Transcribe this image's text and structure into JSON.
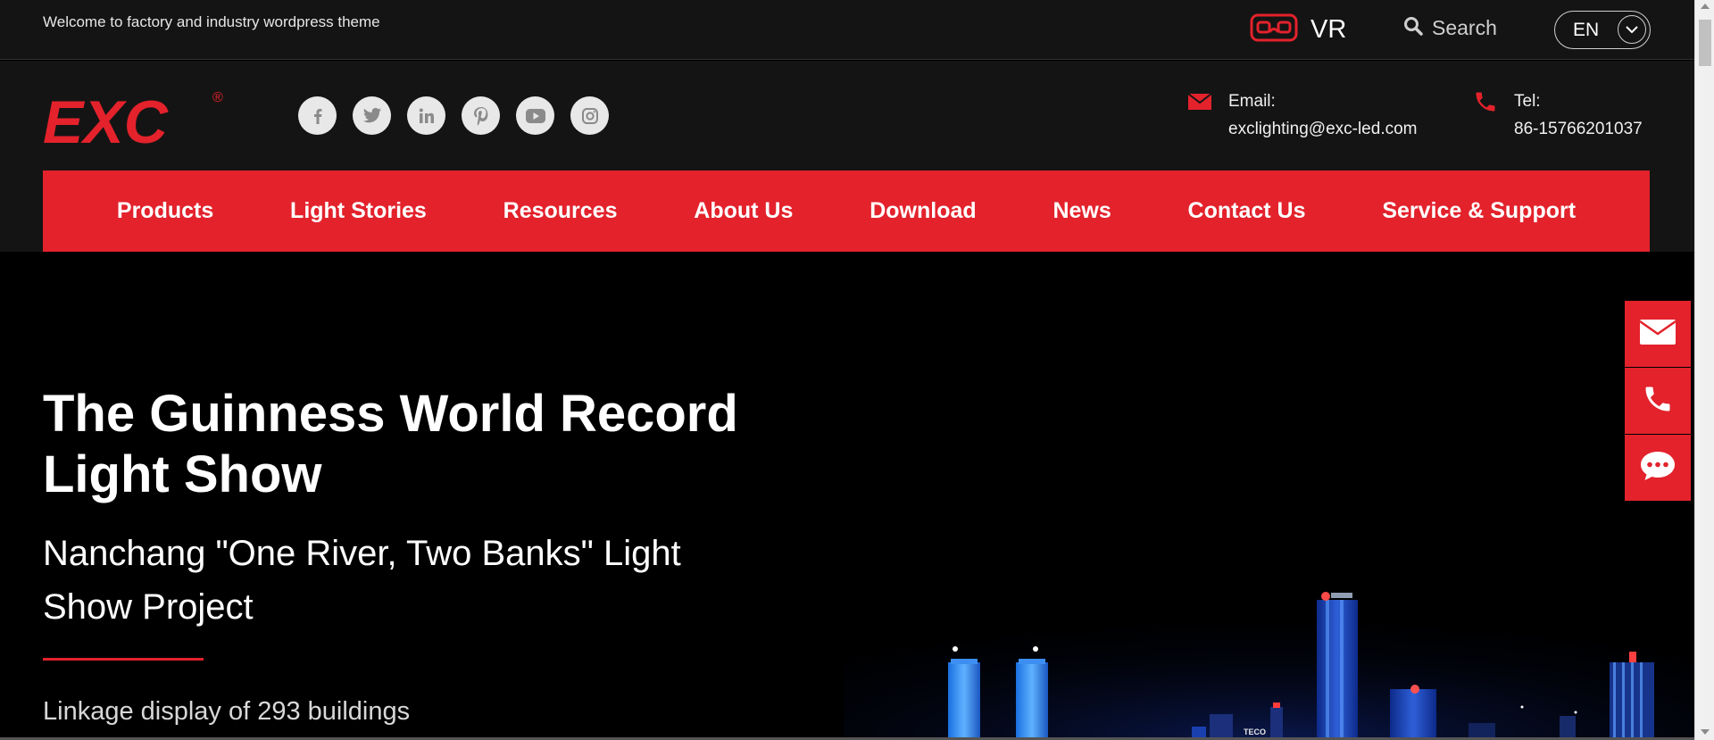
{
  "topbar": {
    "welcome": "Welcome to factory and industry wordpress theme",
    "vr_label": "VR",
    "search_label": "Search",
    "lang_label": "EN"
  },
  "header": {
    "logo_text": "EXC",
    "logo_mark": "®",
    "socials": [
      {
        "icon": "facebook-icon",
        "glyph": "f"
      },
      {
        "icon": "twitter-icon",
        "glyph": "t"
      },
      {
        "icon": "linkedin-icon",
        "glyph": "in"
      },
      {
        "icon": "pinterest-icon",
        "glyph": "p"
      },
      {
        "icon": "youtube-icon",
        "glyph": "yt"
      },
      {
        "icon": "instagram-icon",
        "glyph": "ig"
      }
    ],
    "email_label": "Email:",
    "email_value": "exclighting@exc-led.com",
    "tel_label": "Tel:",
    "tel_value": "86-15766201037"
  },
  "nav": {
    "items": [
      "Products",
      "Light Stories",
      "Resources",
      "About Us",
      "Download",
      "News",
      "Contact Us",
      "Service & Support"
    ]
  },
  "hero": {
    "title": "The Guinness World Record Light Show",
    "subtitle": "Nanchang \"One River, Two Banks\" Light Show Project",
    "desc": "Linkage display of 293 buildings",
    "sign": "TECO"
  },
  "colors": {
    "accent": "#e3222c",
    "dark": "#141414"
  }
}
